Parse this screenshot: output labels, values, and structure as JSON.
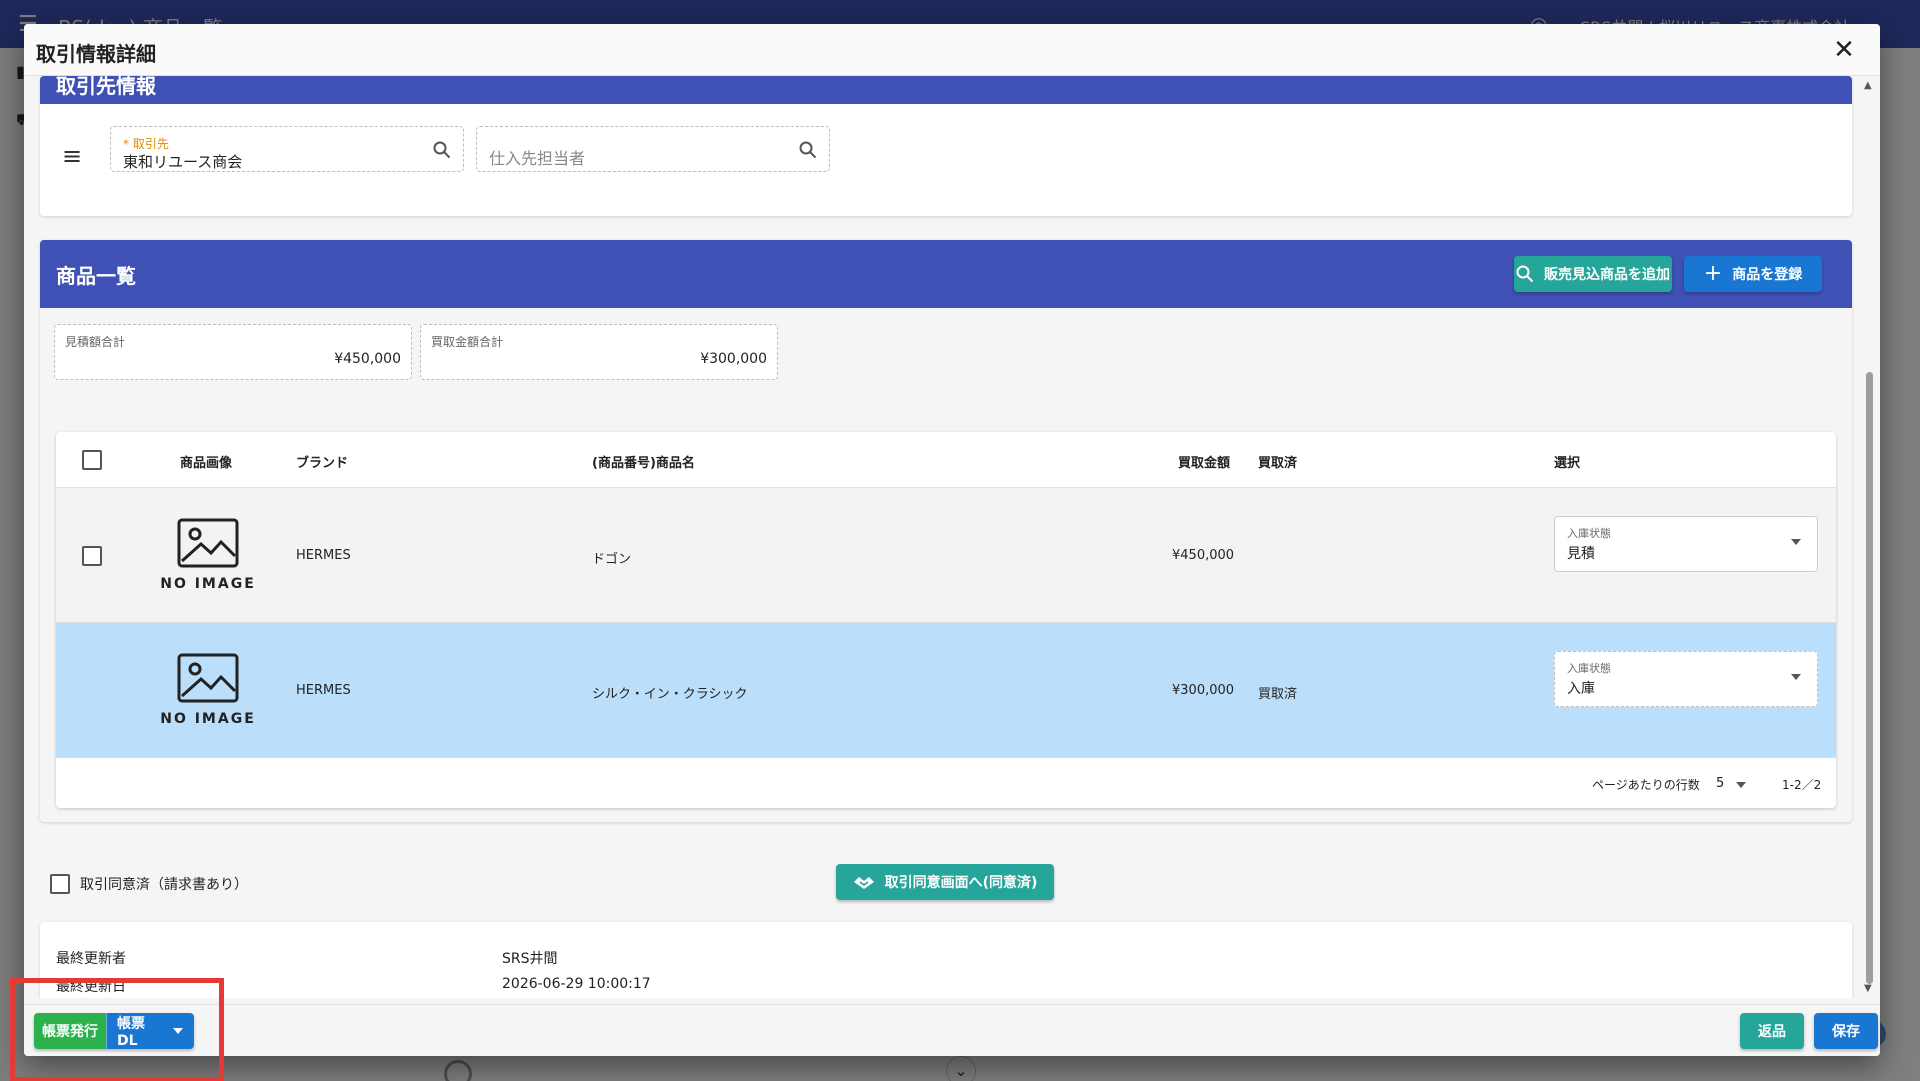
{
  "background": {
    "title": "BS(dev) 商品一覧",
    "user": "SRS井間 | 桜川リユース商事株式会社"
  },
  "modal": {
    "title": "取引情報詳細"
  },
  "partner": {
    "section_title": "取引先情報",
    "partner_field": {
      "label": "取引先",
      "required_mark": "*",
      "value": "東和リユース商会"
    },
    "contact_field": {
      "placeholder": "仕入先担当者"
    }
  },
  "products": {
    "section_title": "商品一覧",
    "add_forecast_button": "販売見込商品を追加",
    "register_button": "商品を登録",
    "estimate_total": {
      "label": "見積額合計",
      "value": "¥450,000"
    },
    "purchase_total": {
      "label": "買取金額合計",
      "value": "¥300,000"
    },
    "table": {
      "headers": {
        "image": "商品画像",
        "brand": "ブランド",
        "name": "(商品番号)商品名",
        "amount": "買取金額",
        "purchased": "買取済",
        "select": "選択"
      },
      "rows": [
        {
          "no_image": "NO IMAGE",
          "brand": "HERMES",
          "name": "ドゴン",
          "amount": "¥450,000",
          "purchased": "",
          "status_label": "入庫状態",
          "status_value": "見積"
        },
        {
          "no_image": "NO IMAGE",
          "brand": "HERMES",
          "name": "シルク・イン・クラシック",
          "amount": "¥300,000",
          "purchased": "買取済",
          "status_label": "入庫状態",
          "status_value": "入庫"
        }
      ],
      "footer": {
        "rows_per_page_label": "ページあたりの行数",
        "rows_per_page": "5",
        "range": "1-2／2"
      }
    }
  },
  "agreement": {
    "checkbox_label": "取引同意済（請求書あり）",
    "button": "取引同意画面へ(同意済)"
  },
  "last_update": {
    "updater_label": "最終更新者",
    "updater_value": "SRS井間",
    "date_label": "最終更新日",
    "date_value": "2026-06-29 10:00:17"
  },
  "footer": {
    "issue_button": "帳票発行",
    "download_button": "帳票DL",
    "return_button": "返品",
    "save_button": "保存"
  },
  "colors": {
    "primary": "#3f51b5",
    "teal": "#26a69a",
    "blue": "#1976d2",
    "green": "#2bb24c",
    "row_selected": "#bbdefb",
    "highlight": "#e53935"
  }
}
